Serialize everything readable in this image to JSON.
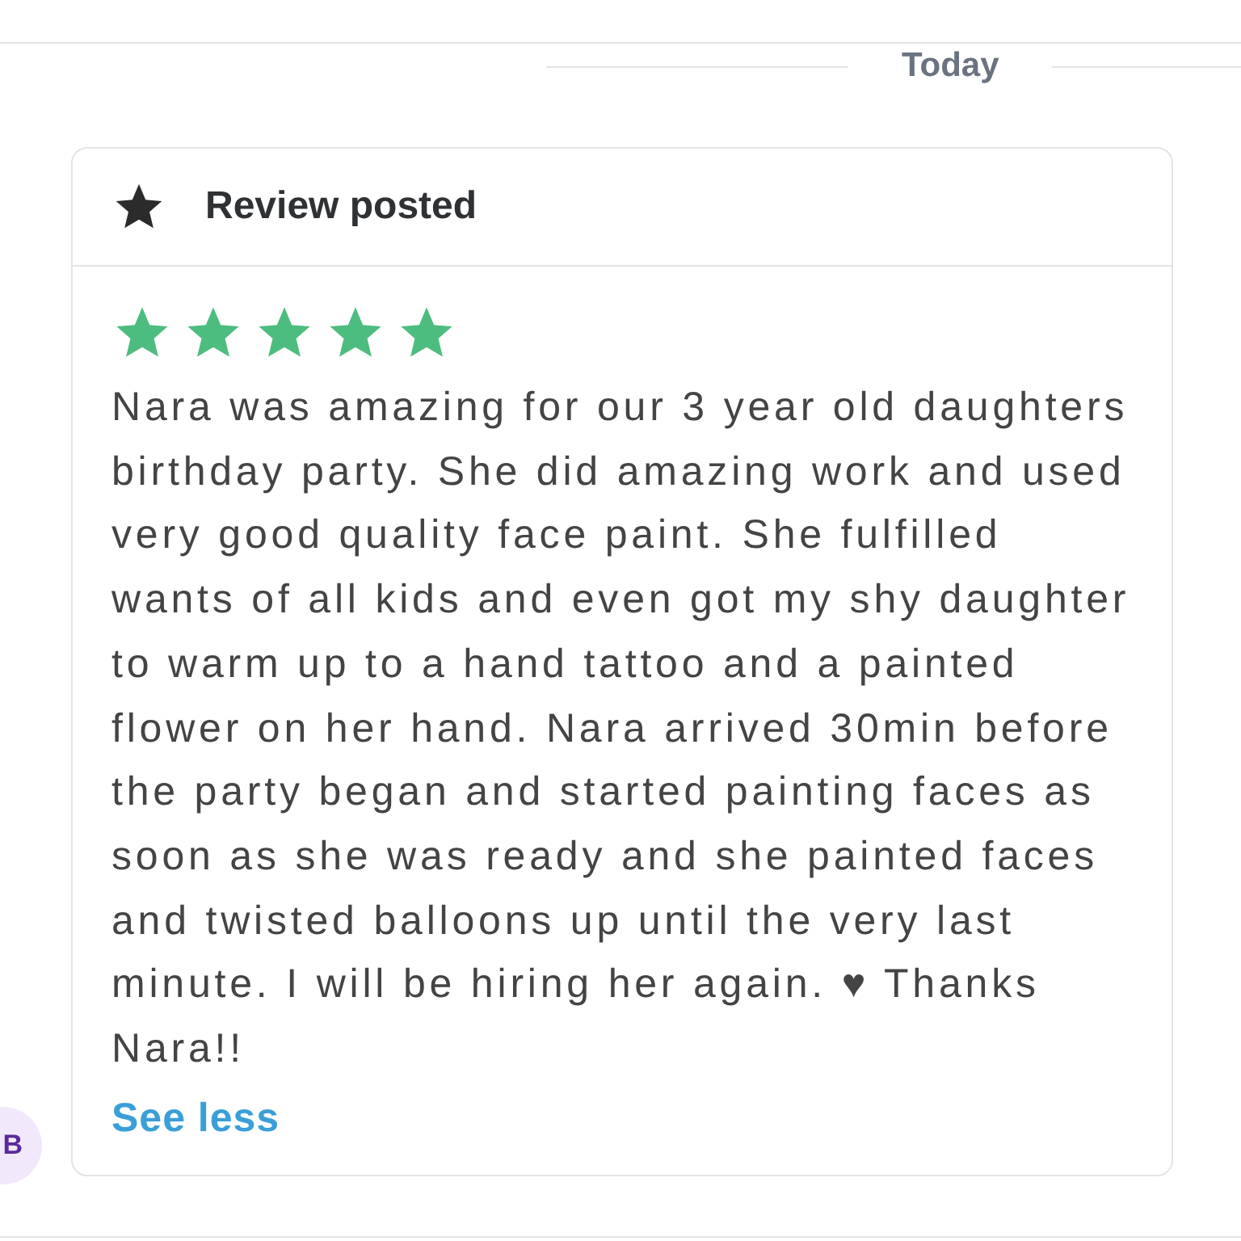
{
  "date_divider": "Today",
  "card": {
    "title": "Review posted",
    "stars": 5,
    "text": "Nara was amazing for our 3 year old daughters birthday party. She did amazing work and used very good quality face paint. She fulfilled wants of all kids and even got my shy daughter to warm up to a hand tattoo and a painted flower on her hand. Nara arrived 30min before the party began and started painting faces as soon as she was ready and she painted faces and twisted balloons up until the very last minute. I will be hiring her again. ♥ Thanks Nara!!",
    "toggle_link": "See less"
  },
  "avatar": {
    "initial": "B"
  }
}
